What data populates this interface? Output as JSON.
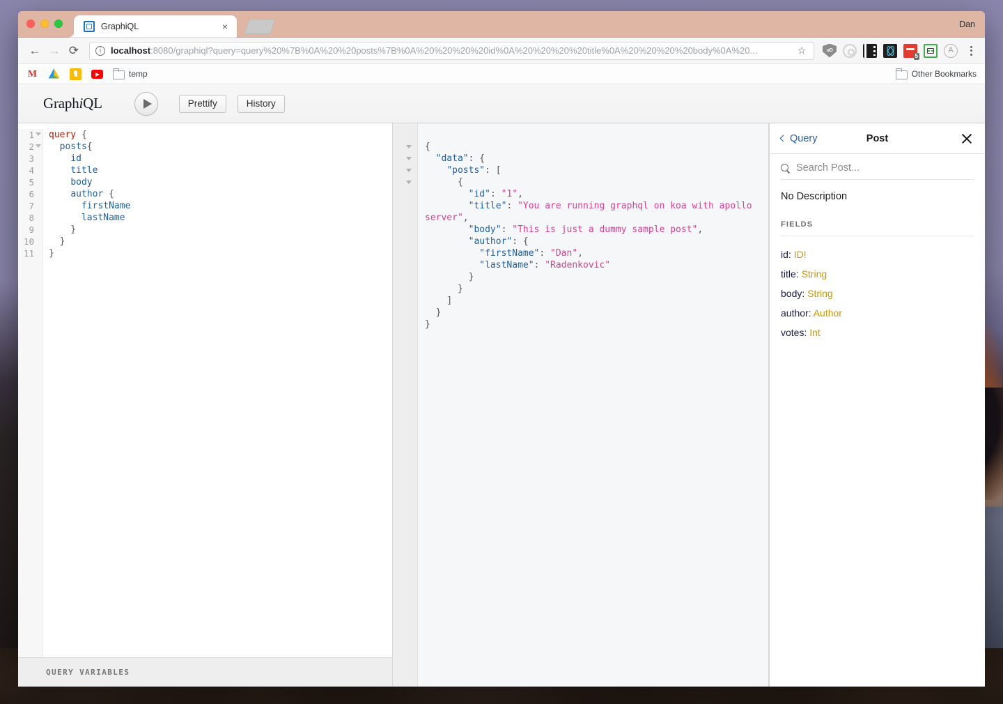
{
  "desktop": {
    "wallpaper_name": "macos-sierra-mountain"
  },
  "browser": {
    "profile_name": "Dan",
    "tab": {
      "title": "GraphiQL",
      "favicon_name": "graphiql-favicon",
      "close_label": "×"
    },
    "new_tab_label": "",
    "nav": {
      "back_label": "←",
      "forward_label": "→",
      "reload_label": "⟳"
    },
    "omnibox": {
      "info_label": "i",
      "url_host": "localhost",
      "url_rest": ":8080/graphiql?query=query%20%7B%0A%20%20posts%7B%0A%20%20%20%20id%0A%20%20%20%20title%0A%20%20%20%20body%0A%20...",
      "star_label": "☆"
    },
    "extensions": [
      {
        "name": "ublock-origin-icon",
        "label": "uO"
      },
      {
        "name": "target-icon",
        "label": ""
      },
      {
        "name": "filmstrip-icon",
        "label": ""
      },
      {
        "name": "react-devtools-icon",
        "label": ""
      },
      {
        "name": "red-extension-icon",
        "label": "",
        "badge": "5"
      },
      {
        "name": "screenshot-crop-icon",
        "label": ""
      },
      {
        "name": "adblock-a-icon",
        "label": "A"
      }
    ],
    "menu_label": "⋮",
    "bookmarks": [
      {
        "name": "gmail",
        "icon": "gmail-icon",
        "label": ""
      },
      {
        "name": "google-drive",
        "icon": "drive-icon",
        "label": ""
      },
      {
        "name": "google-keep",
        "icon": "keep-icon",
        "label": ""
      },
      {
        "name": "youtube",
        "icon": "youtube-icon",
        "label": ""
      },
      {
        "name": "temp-folder",
        "icon": "folder-icon",
        "label": "temp"
      }
    ],
    "other_bookmarks_label": "Other Bookmarks"
  },
  "graphiql": {
    "logo": "GraphiQL",
    "execute_label": "▶",
    "prettify_label": "Prettify",
    "history_label": "History",
    "query_variables_label": "QUERY VARIABLES",
    "editor": {
      "line_numbers": [
        "1",
        "2",
        "3",
        "4",
        "5",
        "6",
        "7",
        "8",
        "9",
        "10",
        "11"
      ],
      "fold_lines": [
        1,
        2
      ],
      "lines": [
        "query {",
        "  posts{",
        "    id",
        "    title",
        "    body",
        "    author {",
        "      firstName",
        "      lastName",
        "    }",
        "  }",
        "}"
      ],
      "text": "query {\n  posts{\n    id\n    title\n    body\n    author {\n      firstName\n      lastName\n    }\n  }\n}"
    },
    "result": {
      "fold_markers": 4,
      "text": "{\n  \"data\": {\n    \"posts\": [\n      {\n        \"id\": \"1\",\n        \"title\": \"You are running graphql on koa with apollo server\",\n        \"body\": \"This is just a dummy sample post\",\n        \"author\": {\n          \"firstName\": \"Dan\",\n          \"lastName\": \"Radenkovic\"\n        }\n      }\n    ]\n  }\n}",
      "data": {
        "posts": [
          {
            "id": "1",
            "title": "You are running graphql on koa with apollo server",
            "body": "This is just a dummy sample post",
            "author": {
              "firstName": "Dan",
              "lastName": "Radenkovic"
            }
          }
        ]
      }
    },
    "docs": {
      "back_label": "Query",
      "title": "Post",
      "close_label": "✕",
      "search_placeholder": "Search Post...",
      "search_value": "",
      "description": "No Description",
      "fields_heading": "FIELDS",
      "fields": [
        {
          "name": "id",
          "separator": ": ",
          "type": "ID!"
        },
        {
          "name": "title",
          "separator": ": ",
          "type": "String"
        },
        {
          "name": "body",
          "separator": ": ",
          "type": "String"
        },
        {
          "name": "author",
          "separator": ": ",
          "type": "Author"
        },
        {
          "name": "votes",
          "separator": ": ",
          "type": "Int"
        }
      ]
    }
  },
  "colors": {
    "keyword": "#b11a04",
    "field": "#1f61a0",
    "json_key": "#1f61a0",
    "json_string": "#d64292",
    "docs_type": "#ca9800",
    "docs_link": "#2c60aa"
  }
}
